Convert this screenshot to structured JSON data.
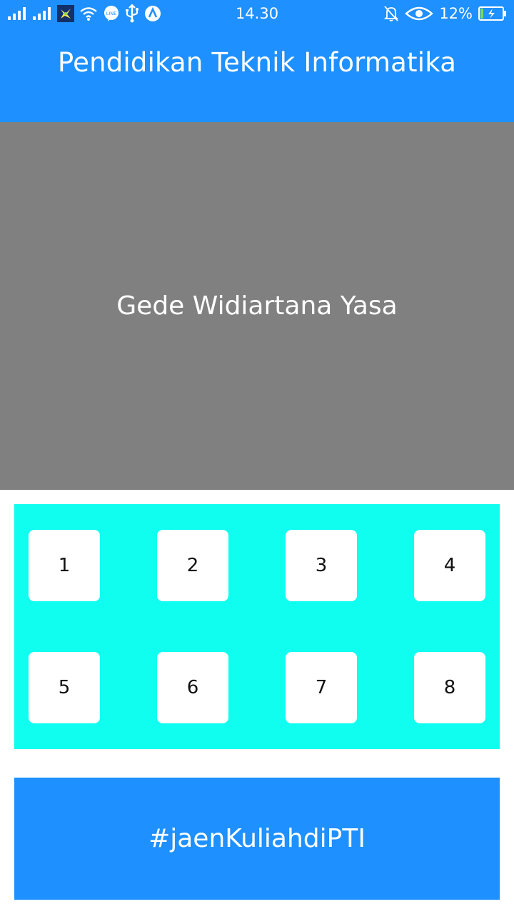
{
  "status_bar": {
    "time": "14.30",
    "battery_percent": "12%",
    "line_badge": "LINE",
    "icons": [
      "signal-1-icon",
      "signal-2-icon",
      "app-notification-icon",
      "wifi-icon",
      "line-icon",
      "usb-icon",
      "app-a-icon",
      "mute-icon",
      "eye-icon",
      "battery-charging-icon"
    ]
  },
  "header": {
    "title": "Pendidikan Teknik Informatika"
  },
  "banner": {
    "name": "Gede Widiartana Yasa"
  },
  "grid": {
    "buttons": [
      "1",
      "2",
      "3",
      "4",
      "5",
      "6",
      "7",
      "8"
    ]
  },
  "footer": {
    "hashtag": "#jaenKuliahdiPTI"
  },
  "colors": {
    "primary": "#1E90FF",
    "banner_bg": "#808080",
    "grid_bg": "#0FFEF0",
    "button_bg": "#FFFFFF",
    "text_light": "#FFFFFF"
  }
}
